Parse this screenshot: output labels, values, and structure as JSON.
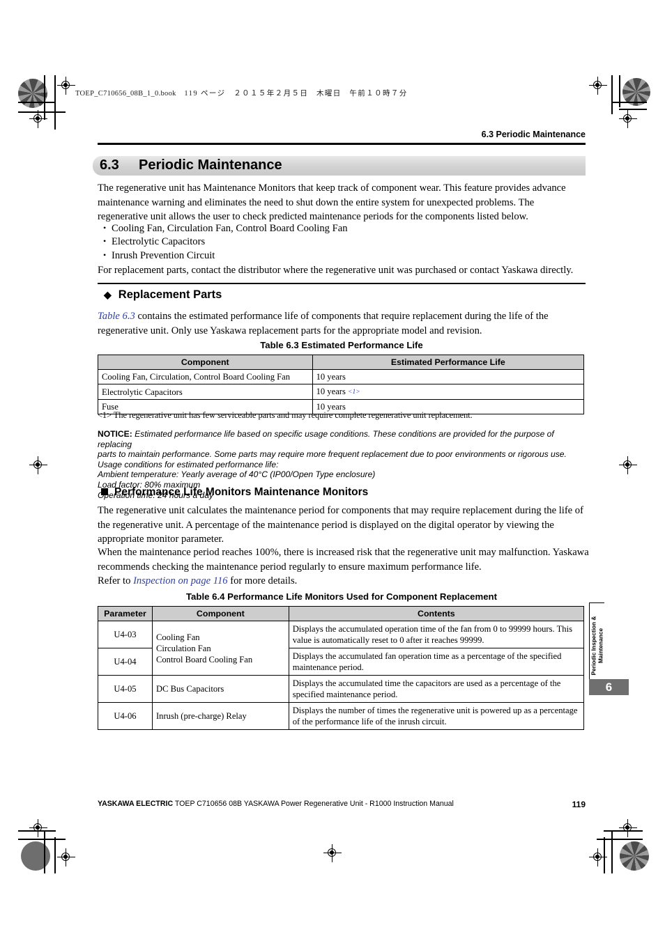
{
  "print_marks": {
    "book_line": "TOEP_C710656_08B_1_0.book",
    "book_page": "119 ページ",
    "book_date": "２０１５年２月５日",
    "book_day": "木曜日",
    "book_time": "午前１０時７分"
  },
  "running_head": "6.3  Periodic Maintenance",
  "section": {
    "number": "6.3",
    "title": "Periodic Maintenance",
    "intro": "The regenerative unit has Maintenance Monitors that keep track of component wear. This feature provides advance maintenance warning and eliminates the need to shut down the entire system for unexpected problems. The regenerative unit allows the user to check predicted maintenance periods for the components listed below.",
    "bullets": [
      "Cooling Fan, Circulation Fan, Control Board Cooling Fan",
      "Electrolytic Capacitors",
      "Inrush Prevention Circuit"
    ],
    "closing": "For replacement parts, contact the distributor where the regenerative unit was purchased or contact Yaskawa directly."
  },
  "replacement_parts": {
    "heading": "Replacement Parts",
    "heading_mark": "diamond-bullet-icon",
    "intro_link": "Table 6.3",
    "intro_rest": " contains the estimated performance life of components that require replacement during the life of the regenerative unit. Only use Yaskawa replacement parts for the appropriate model and revision."
  },
  "table_63": {
    "caption": "Table 6.3  Estimated Performance Life",
    "headers": [
      "Component",
      "Estimated Performance Life"
    ],
    "rows": [
      {
        "component": "Cooling Fan, Circulation, Control Board Cooling Fan",
        "life": "10 years",
        "footnote": ""
      },
      {
        "component": "Electrolytic Capacitors",
        "life": "10 years",
        "footnote": "<1>"
      },
      {
        "component": "Fuse",
        "life": "10 years",
        "footnote": ""
      }
    ]
  },
  "footnote_1": "<1> The regenerative unit has few serviceable parts and may require complete regenerative unit replacement.",
  "notice": {
    "label": "NOTICE:",
    "line1": " Estimated performance life based on specific usage conditions. These conditions are provided for the purpose of replacing",
    "line2": "parts to maintain performance. Some parts may require more frequent replacement due to poor environments or rigorous use.",
    "line3": "Usage conditions for estimated performance life:",
    "line4": "Ambient temperature: Yearly average of 40°C (IP00/Open Type enclosure)",
    "line5": "Load factor: 80% maximum",
    "line6": "Operation time: 24 hours a day"
  },
  "monitors": {
    "heading": "Performance Life Monitors Maintenance Monitors",
    "heading_mark": "square-bullet-icon",
    "para1": "The regenerative unit calculates the maintenance period for components that may require replacement during the life of the regenerative unit. A percentage of the maintenance period is displayed on the digital operator by viewing the appropriate monitor parameter.",
    "para2": "When the maintenance period reaches 100%, there is increased risk that the regenerative unit may malfunction. Yaskawa recommends checking the maintenance period regularly to ensure maximum performance life.",
    "refer_prefix": "Refer to ",
    "refer_link": "Inspection on page 116",
    "refer_suffix": " for more details."
  },
  "table_64": {
    "caption": "Table 6.4  Performance Life Monitors Used for Component Replacement",
    "headers": [
      "Parameter",
      "Component",
      "Contents"
    ],
    "rows": [
      {
        "parameter": "U4-03",
        "component": "Cooling Fan\nCirculation Fan\nControl Board Cooling Fan",
        "contents": "Displays the accumulated operation time of the fan from 0 to 99999 hours. This value is automatically reset to 0 after it reaches 99999."
      },
      {
        "parameter": "U4-04",
        "component": "",
        "contents": "Displays the accumulated fan operation time as a percentage of the specified maintenance period."
      },
      {
        "parameter": "U4-05",
        "component": "DC Bus Capacitors",
        "contents": "Displays the accumulated time the capacitors are used as a percentage of the specified maintenance period."
      },
      {
        "parameter": "U4-06",
        "component": "Inrush (pre-charge) Relay",
        "contents": "Displays the number of times the regenerative unit is powered up as a percentage of the performance life of the inrush circuit."
      }
    ]
  },
  "side_tab": {
    "label_line1": "Periodic Inspection &",
    "label_line2": "Maintenance",
    "chapter": "6"
  },
  "footer": {
    "brand": "YASKAWA ELECTRIC",
    "text": " TOEP C710656 08B YASKAWA Power Regenerative Unit - R1000 Instruction Manual",
    "page_number": "119"
  },
  "colors": {
    "xref_blue": "#2c3fa8",
    "table_header_gray": "#cdcdcd",
    "banner_gray": "#d2d2d2",
    "chapter_tab_gray": "#6f6f6f"
  }
}
